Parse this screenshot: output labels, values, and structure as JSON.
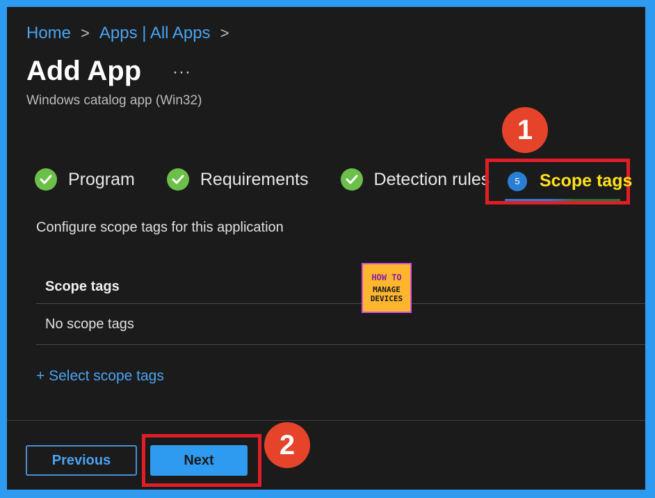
{
  "breadcrumb": {
    "items": [
      "Home",
      "Apps | All Apps"
    ],
    "separator": ">"
  },
  "header": {
    "title": "Add App",
    "more": "···",
    "subtitle": "Windows catalog app (Win32)"
  },
  "tabs": [
    {
      "label": "Program",
      "state": "complete"
    },
    {
      "label": "Requirements",
      "state": "complete"
    },
    {
      "label": "Detection rules",
      "state": "complete"
    },
    {
      "label": "Scope tags",
      "state": "active",
      "step": "5"
    }
  ],
  "content": {
    "description": "Configure scope tags for this application",
    "table_header": "Scope tags",
    "table_empty": "No scope tags",
    "select_link": "+ Select scope tags"
  },
  "logo": {
    "line1": "HOW TO",
    "line2": "MANAGE",
    "line3": "DEVICES"
  },
  "callouts": [
    "1",
    "2"
  ],
  "footer": {
    "previous_label": "Previous",
    "next_label": "Next"
  },
  "colors": {
    "accent": "#2f9bf0",
    "check": "#6cc04a",
    "highlight": "#e01e27",
    "active_tab_text": "#ffe21a",
    "callout": "#e5432a"
  }
}
